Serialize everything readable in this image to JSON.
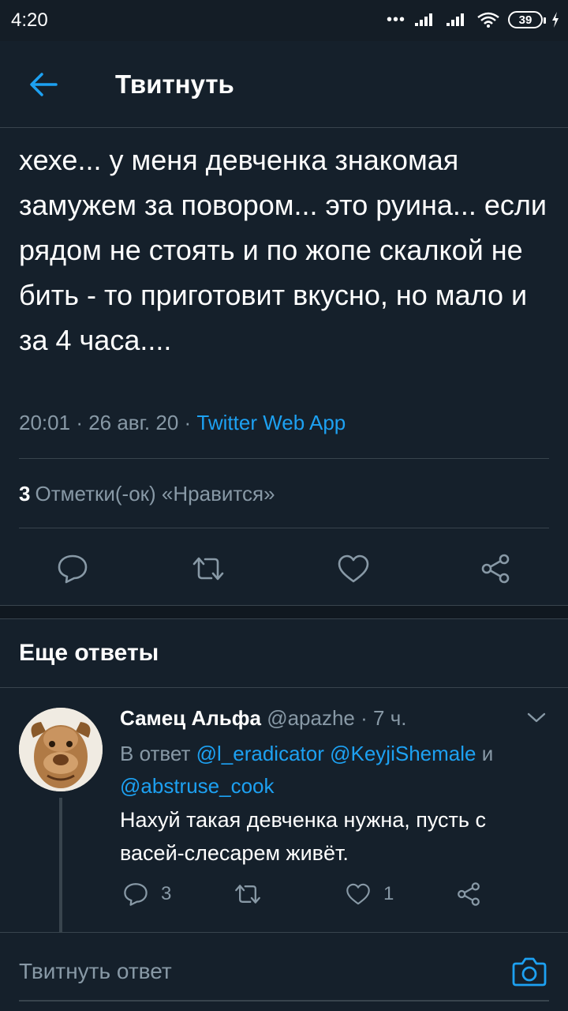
{
  "status_bar": {
    "time": "4:20",
    "battery": "39"
  },
  "app_bar": {
    "title": "Твитнуть"
  },
  "tweet": {
    "text": "хехе... у меня девченка знакомая замужем за поворoм... это руина... если рядом не стоять и по жопе скалкой не бить - то приготовит вкусно, но мало и за 4 часа....",
    "time": "20:01",
    "date": "26 авг. 20",
    "source": "Twitter Web App",
    "likes_count": "3",
    "likes_label": "Отметки(-ок) «Нравится»"
  },
  "more_replies": {
    "title": "Еще ответы"
  },
  "reply": {
    "name": "Самец Альфа",
    "handle": "@apazhe",
    "time_ago": "7 ч.",
    "reply_prefix": "В ответ",
    "mention_1": "@l_eradicator",
    "mention_2": "@KeyjiShemale",
    "and": "и",
    "mention_3": "@abstruse_cook",
    "text": "Нахуй такая девченка нужна, пусть с васей-слесарем живёт.",
    "reply_count": "3",
    "like_count": "1"
  },
  "compose": {
    "placeholder": "Твитнуть ответ"
  },
  "colors": {
    "background": "#15202b",
    "accent": "#1da1f2",
    "muted": "#8899a6",
    "divider": "#38444d"
  },
  "icons": {
    "back": "arrow-left-icon",
    "reply": "speech-bubble-icon",
    "retweet": "retweet-icon",
    "like": "heart-icon",
    "share": "share-icon",
    "caret": "chevron-down-icon",
    "camera": "camera-icon"
  }
}
